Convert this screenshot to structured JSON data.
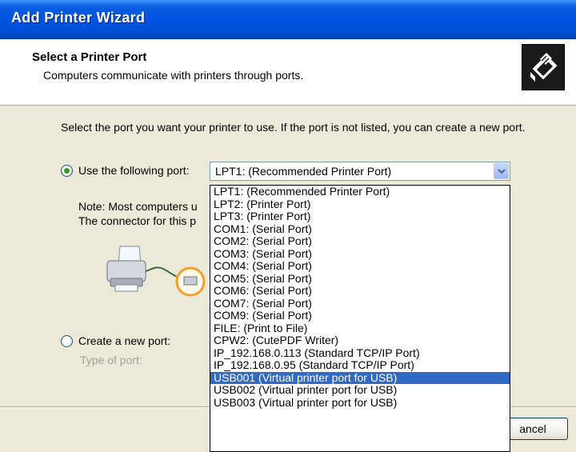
{
  "window": {
    "title": "Add Printer Wizard"
  },
  "header": {
    "title": "Select a Printer Port",
    "subtitle": "Computers communicate with printers through ports."
  },
  "intro_text": "Select the port you want your printer to use.  If the port is not listed, you can create a new port.",
  "use_port": {
    "label": "Use the following port:",
    "selected": true,
    "selected_value": "LPT1: (Recommended Printer Port)"
  },
  "note": {
    "line1": "Note: Most computers u",
    "line2": "The connector for this p"
  },
  "create_port": {
    "label": "Create a new port:",
    "selected": false,
    "type_label": "Type of port:"
  },
  "port_options": [
    "LPT1: (Recommended Printer Port)",
    "LPT2: (Printer Port)",
    "LPT3: (Printer Port)",
    "COM1: (Serial Port)",
    "COM2: (Serial Port)",
    "COM3: (Serial Port)",
    "COM4: (Serial Port)",
    "COM5: (Serial Port)",
    "COM6: (Serial Port)",
    "COM7: (Serial Port)",
    "COM9: (Serial Port)",
    "FILE: (Print to File)",
    "CPW2: (CutePDF Writer)",
    "IP_192.168.0.113 (Standard TCP/IP Port)",
    "IP_192.168.0.95 (Standard TCP/IP Port)",
    "USB001 (Virtual printer port for USB)",
    "USB002 (Virtual printer port for USB)",
    "USB003 (Virtual printer port for USB)"
  ],
  "highlighted_option": "USB001 (Virtual printer port for USB)",
  "buttons": {
    "cancel": "ancel"
  },
  "icons": {
    "wizard": "printer-wizard-icon",
    "dropdown": "chevron-down-icon",
    "illustration": "printer-cable-illustration"
  },
  "colors": {
    "titlebar": "#0054e3",
    "selection": "#316ac5",
    "dialog_bg": "#ece9d8",
    "connector_highlight": "#f0a030"
  }
}
